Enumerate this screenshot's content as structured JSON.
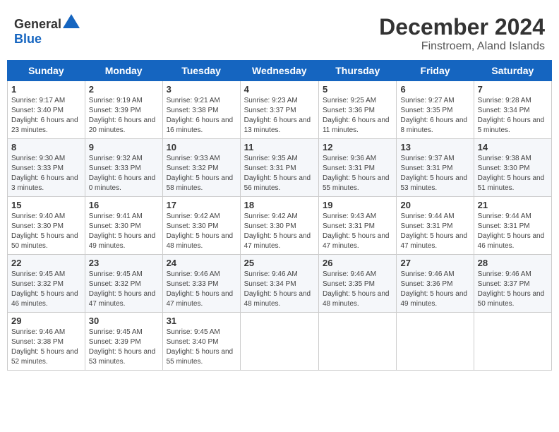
{
  "header": {
    "logo_general": "General",
    "logo_blue": "Blue",
    "month": "December 2024",
    "location": "Finstroem, Aland Islands"
  },
  "weekdays": [
    "Sunday",
    "Monday",
    "Tuesday",
    "Wednesday",
    "Thursday",
    "Friday",
    "Saturday"
  ],
  "weeks": [
    [
      {
        "day": "1",
        "sunrise": "Sunrise: 9:17 AM",
        "sunset": "Sunset: 3:40 PM",
        "daylight": "Daylight: 6 hours and 23 minutes."
      },
      {
        "day": "2",
        "sunrise": "Sunrise: 9:19 AM",
        "sunset": "Sunset: 3:39 PM",
        "daylight": "Daylight: 6 hours and 20 minutes."
      },
      {
        "day": "3",
        "sunrise": "Sunrise: 9:21 AM",
        "sunset": "Sunset: 3:38 PM",
        "daylight": "Daylight: 6 hours and 16 minutes."
      },
      {
        "day": "4",
        "sunrise": "Sunrise: 9:23 AM",
        "sunset": "Sunset: 3:37 PM",
        "daylight": "Daylight: 6 hours and 13 minutes."
      },
      {
        "day": "5",
        "sunrise": "Sunrise: 9:25 AM",
        "sunset": "Sunset: 3:36 PM",
        "daylight": "Daylight: 6 hours and 11 minutes."
      },
      {
        "day": "6",
        "sunrise": "Sunrise: 9:27 AM",
        "sunset": "Sunset: 3:35 PM",
        "daylight": "Daylight: 6 hours and 8 minutes."
      },
      {
        "day": "7",
        "sunrise": "Sunrise: 9:28 AM",
        "sunset": "Sunset: 3:34 PM",
        "daylight": "Daylight: 6 hours and 5 minutes."
      }
    ],
    [
      {
        "day": "8",
        "sunrise": "Sunrise: 9:30 AM",
        "sunset": "Sunset: 3:33 PM",
        "daylight": "Daylight: 6 hours and 3 minutes."
      },
      {
        "day": "9",
        "sunrise": "Sunrise: 9:32 AM",
        "sunset": "Sunset: 3:33 PM",
        "daylight": "Daylight: 6 hours and 0 minutes."
      },
      {
        "day": "10",
        "sunrise": "Sunrise: 9:33 AM",
        "sunset": "Sunset: 3:32 PM",
        "daylight": "Daylight: 5 hours and 58 minutes."
      },
      {
        "day": "11",
        "sunrise": "Sunrise: 9:35 AM",
        "sunset": "Sunset: 3:31 PM",
        "daylight": "Daylight: 5 hours and 56 minutes."
      },
      {
        "day": "12",
        "sunrise": "Sunrise: 9:36 AM",
        "sunset": "Sunset: 3:31 PM",
        "daylight": "Daylight: 5 hours and 55 minutes."
      },
      {
        "day": "13",
        "sunrise": "Sunrise: 9:37 AM",
        "sunset": "Sunset: 3:31 PM",
        "daylight": "Daylight: 5 hours and 53 minutes."
      },
      {
        "day": "14",
        "sunrise": "Sunrise: 9:38 AM",
        "sunset": "Sunset: 3:30 PM",
        "daylight": "Daylight: 5 hours and 51 minutes."
      }
    ],
    [
      {
        "day": "15",
        "sunrise": "Sunrise: 9:40 AM",
        "sunset": "Sunset: 3:30 PM",
        "daylight": "Daylight: 5 hours and 50 minutes."
      },
      {
        "day": "16",
        "sunrise": "Sunrise: 9:41 AM",
        "sunset": "Sunset: 3:30 PM",
        "daylight": "Daylight: 5 hours and 49 minutes."
      },
      {
        "day": "17",
        "sunrise": "Sunrise: 9:42 AM",
        "sunset": "Sunset: 3:30 PM",
        "daylight": "Daylight: 5 hours and 48 minutes."
      },
      {
        "day": "18",
        "sunrise": "Sunrise: 9:42 AM",
        "sunset": "Sunset: 3:30 PM",
        "daylight": "Daylight: 5 hours and 47 minutes."
      },
      {
        "day": "19",
        "sunrise": "Sunrise: 9:43 AM",
        "sunset": "Sunset: 3:31 PM",
        "daylight": "Daylight: 5 hours and 47 minutes."
      },
      {
        "day": "20",
        "sunrise": "Sunrise: 9:44 AM",
        "sunset": "Sunset: 3:31 PM",
        "daylight": "Daylight: 5 hours and 47 minutes."
      },
      {
        "day": "21",
        "sunrise": "Sunrise: 9:44 AM",
        "sunset": "Sunset: 3:31 PM",
        "daylight": "Daylight: 5 hours and 46 minutes."
      }
    ],
    [
      {
        "day": "22",
        "sunrise": "Sunrise: 9:45 AM",
        "sunset": "Sunset: 3:32 PM",
        "daylight": "Daylight: 5 hours and 46 minutes."
      },
      {
        "day": "23",
        "sunrise": "Sunrise: 9:45 AM",
        "sunset": "Sunset: 3:32 PM",
        "daylight": "Daylight: 5 hours and 47 minutes."
      },
      {
        "day": "24",
        "sunrise": "Sunrise: 9:46 AM",
        "sunset": "Sunset: 3:33 PM",
        "daylight": "Daylight: 5 hours and 47 minutes."
      },
      {
        "day": "25",
        "sunrise": "Sunrise: 9:46 AM",
        "sunset": "Sunset: 3:34 PM",
        "daylight": "Daylight: 5 hours and 48 minutes."
      },
      {
        "day": "26",
        "sunrise": "Sunrise: 9:46 AM",
        "sunset": "Sunset: 3:35 PM",
        "daylight": "Daylight: 5 hours and 48 minutes."
      },
      {
        "day": "27",
        "sunrise": "Sunrise: 9:46 AM",
        "sunset": "Sunset: 3:36 PM",
        "daylight": "Daylight: 5 hours and 49 minutes."
      },
      {
        "day": "28",
        "sunrise": "Sunrise: 9:46 AM",
        "sunset": "Sunset: 3:37 PM",
        "daylight": "Daylight: 5 hours and 50 minutes."
      }
    ],
    [
      {
        "day": "29",
        "sunrise": "Sunrise: 9:46 AM",
        "sunset": "Sunset: 3:38 PM",
        "daylight": "Daylight: 5 hours and 52 minutes."
      },
      {
        "day": "30",
        "sunrise": "Sunrise: 9:45 AM",
        "sunset": "Sunset: 3:39 PM",
        "daylight": "Daylight: 5 hours and 53 minutes."
      },
      {
        "day": "31",
        "sunrise": "Sunrise: 9:45 AM",
        "sunset": "Sunset: 3:40 PM",
        "daylight": "Daylight: 5 hours and 55 minutes."
      },
      null,
      null,
      null,
      null
    ]
  ]
}
